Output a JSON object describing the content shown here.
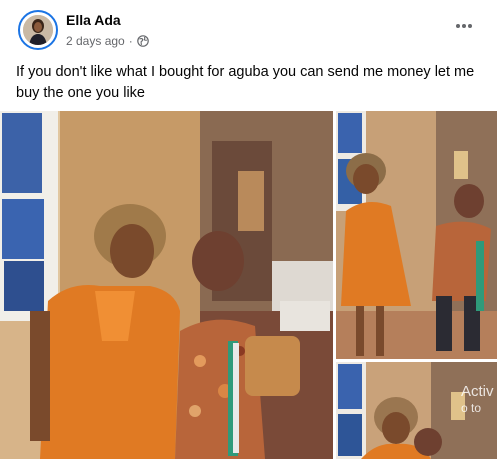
{
  "post": {
    "author": "Ella Ada",
    "time": "2 days ago",
    "separator": "·",
    "caption": "If you don't like what I bought for aguba you can send me money let me buy the one you like"
  },
  "icons": {
    "avatar": "avatar",
    "privacy": "globe-icon",
    "more": "more-options-icon"
  },
  "overlay": {
    "line1": "Activ",
    "line2": "o to"
  },
  "colors": {
    "brand": "#1b74e4",
    "text": "#050505",
    "secondary": "#65676b"
  }
}
